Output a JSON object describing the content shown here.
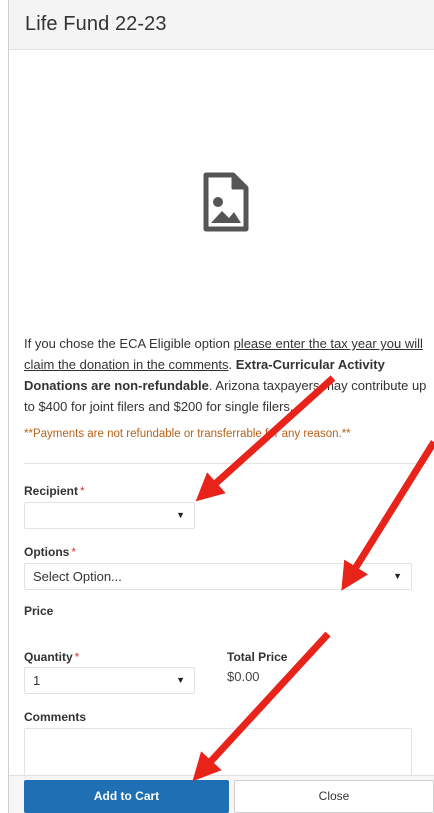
{
  "header": {
    "title": "Life Fund 22-23"
  },
  "description": {
    "p1": "If you chose the ECA Eligible option ",
    "p2_underline": "please enter the tax year you will claim the donation in the comments",
    "p3": ". ",
    "p4_bold": "Extra-Curricular Activity Donations are non-refundable",
    "p5": ". Arizona taxpayers may contribute up to $400 for joint filers and $200 for single filers."
  },
  "notice": "**Payments are not refundable or transferrable for any reason.**",
  "form": {
    "recipient": {
      "label": "Recipient",
      "required": "*",
      "value": ""
    },
    "options": {
      "label": "Options",
      "required": "*",
      "value": "Select Option..."
    },
    "price": {
      "label": "Price"
    },
    "quantity": {
      "label": "Quantity",
      "required": "*",
      "value": "1"
    },
    "total": {
      "label": "Total Price",
      "value": "$0.00"
    },
    "comments": {
      "label": "Comments",
      "value": ""
    }
  },
  "icons": {
    "caret": "▼",
    "image_placeholder": "image-file-icon",
    "annotation_color": "#e8231a"
  },
  "footer": {
    "add_to_cart": "Add to Cart",
    "close": "Close"
  }
}
